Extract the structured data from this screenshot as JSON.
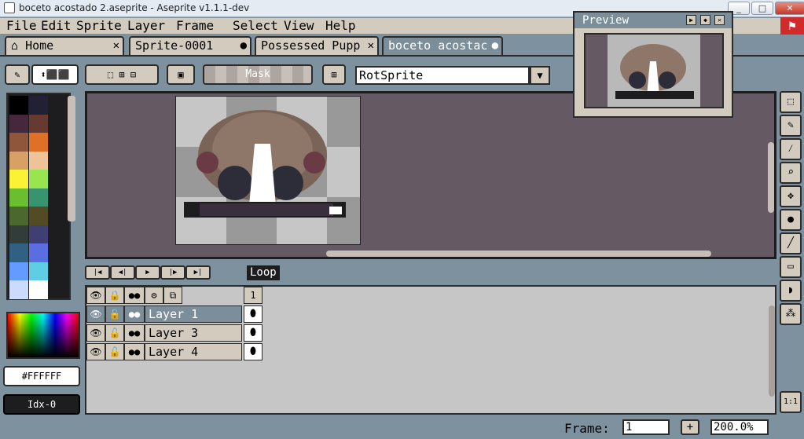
{
  "window": {
    "title": "boceto acostado 2.aseprite - Aseprite v1.1.1-dev",
    "minimize": "_",
    "maximize": "□",
    "close": "✕"
  },
  "menu": [
    "File",
    "Edit",
    "Sprite",
    "Layer",
    "Frame",
    "Select",
    "View",
    "Help"
  ],
  "tabs": [
    {
      "label": "Home",
      "marker": "✕",
      "icon": "home-icon"
    },
    {
      "label": "Sprite-0001",
      "marker": "●"
    },
    {
      "label": "Possessed Pupp",
      "marker": "✕"
    },
    {
      "label": "boceto acostac",
      "marker": "●",
      "active": true
    }
  ],
  "toolbar": {
    "mask_label": "Mask",
    "rotation_algorithm": "RotSprite"
  },
  "preview": {
    "title": "Preview"
  },
  "color": {
    "hex": "#FFFFFF",
    "index": "Idx-0"
  },
  "timeline": {
    "loop_label": "Loop",
    "frame_header": "1",
    "layers": [
      "Layer 1",
      "Layer 3",
      "Layer 4"
    ]
  },
  "status": {
    "frame_label": "Frame:",
    "frame_value": "1",
    "add_label": "+",
    "zoom": "200.0%",
    "zoom_reset": "1:1"
  },
  "palette_colors": [
    "#000000",
    "#222034",
    "#45283c",
    "#663931",
    "#8f563b",
    "#df7126",
    "#d9a066",
    "#eec39a",
    "#fbf236",
    "#99e550",
    "#6abe30",
    "#37946e",
    "#4b692f",
    "#524b24",
    "#323c39",
    "#3f3f74",
    "#306082",
    "#5b6ee1",
    "#639bff",
    "#5fcde4",
    "#cbdbfc",
    "#ffffff"
  ]
}
